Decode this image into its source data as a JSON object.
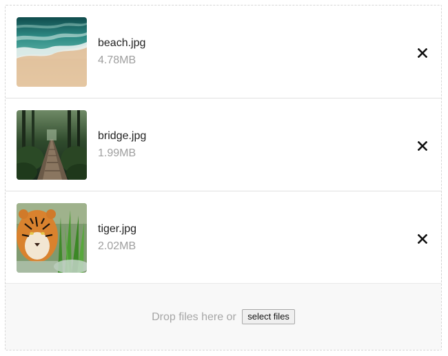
{
  "files": [
    {
      "name": "beach.jpg",
      "size": "4.78MB",
      "thumbnail": "beach-aerial-photo"
    },
    {
      "name": "bridge.jpg",
      "size": "1.99MB",
      "thumbnail": "forest-wooden-bridge-photo"
    },
    {
      "name": "tiger.jpg",
      "size": "2.02MB",
      "thumbnail": "tiger-in-water-photo"
    }
  ],
  "remove_icon": "close-icon",
  "dropzone": {
    "prompt": "Drop files here or",
    "select_label": "select files"
  },
  "colors": {
    "file_name": "#222222",
    "file_size": "#9e9e9e",
    "dropzone_bg": "#f8f8f8",
    "dropzone_text": "#a6a6a6"
  }
}
